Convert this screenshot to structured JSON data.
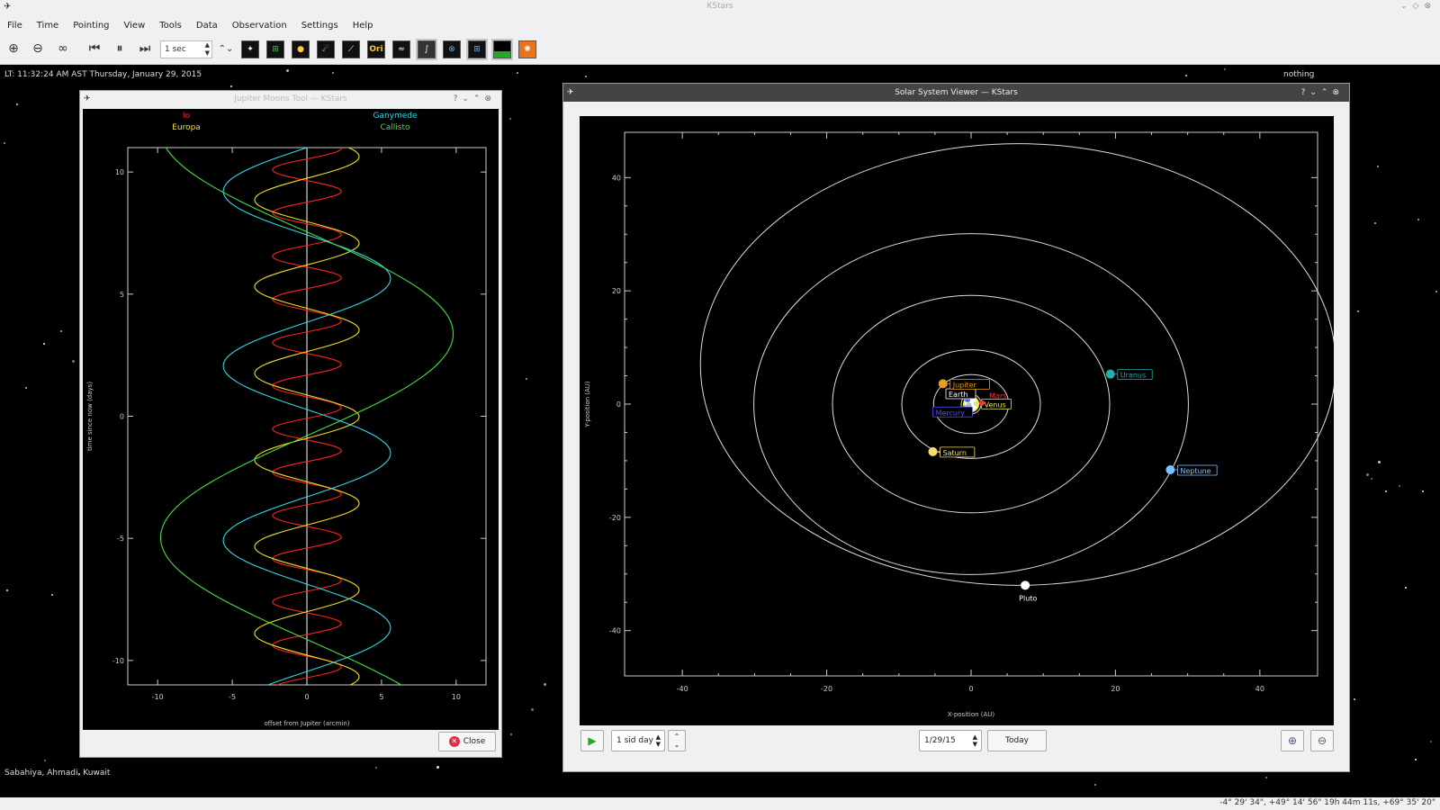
{
  "app": {
    "title": "KStars"
  },
  "menu": [
    "File",
    "Time",
    "Pointing",
    "View",
    "Tools",
    "Data",
    "Observation",
    "Settings",
    "Help"
  ],
  "toolbar": {
    "time_step": "1 sec",
    "view_buttons": [
      "stars",
      "const",
      "planets",
      "deep-sky",
      "lines",
      "Ori",
      "milky",
      "horizon",
      "grid",
      "eq",
      "ground",
      "fov"
    ]
  },
  "status": {
    "local_time": "LT: 11:32:24 AM AST   Thursday, January 29, 2015",
    "object": "nothing",
    "location": "Sabahiya, Ahmadi, Kuwait",
    "coords": "-4° 29' 34\", +49° 14' 56\"   19h 44m 11s, +69° 35' 20\""
  },
  "jupiter_window": {
    "title": "Jupiter Moons Tool — KStars",
    "close_label": "Close",
    "colors": {
      "io": "#ff2020",
      "europa": "#f0e020",
      "ganymede": "#30d8e8",
      "callisto": "#40e040"
    },
    "chart_data": {
      "type": "line",
      "xlabel": "offset from Jupiter (arcmin)",
      "ylabel": "time since now (days)",
      "xlim": [
        -12,
        12
      ],
      "ylim": [
        -11,
        11
      ],
      "x_ticks": [
        "-10",
        "-5",
        "0",
        "5",
        "10"
      ],
      "y_ticks": [
        "10",
        "5",
        "0",
        "-5",
        "-10"
      ],
      "series": [
        {
          "name": "Io",
          "amplitude": 2.3,
          "period_days": 1.77,
          "phase": 0.3
        },
        {
          "name": "Europa",
          "amplitude": 3.5,
          "period_days": 3.55,
          "phase": 1.6
        },
        {
          "name": "Ganymede",
          "amplitude": 5.6,
          "period_days": 7.15,
          "phase": 2.9
        },
        {
          "name": "Callisto",
          "amplitude": 9.8,
          "period_days": 16.69,
          "phase": 0.3
        }
      ]
    }
  },
  "solar_window": {
    "title": "Solar System Viewer — KStars",
    "step": "1 sid day",
    "date": "1/29/15",
    "today_label": "Today",
    "chart_data": {
      "type": "scatter",
      "xlabel": "X-position (AU)",
      "ylabel": "Y-position (AU)",
      "xlim": [
        -48,
        48
      ],
      "ylim": [
        -48,
        48
      ],
      "x_ticks": [
        "-40",
        "-20",
        "0",
        "20",
        "40"
      ],
      "y_ticks": [
        "40",
        "20",
        "0",
        "-20",
        "-40"
      ],
      "orbits": [
        {
          "name": "Jupiter",
          "a": 5.2,
          "cx": 0,
          "cy": 0
        },
        {
          "name": "Saturn",
          "a": 9.6,
          "cx": 0,
          "cy": 0
        },
        {
          "name": "Uranus",
          "a": 19.2,
          "cx": 0,
          "cy": 0
        },
        {
          "name": "Neptune",
          "a": 30.1,
          "cx": 0,
          "cy": 0
        },
        {
          "name": "Pluto",
          "rx": 44,
          "ry": 39,
          "cx": 6.5,
          "cy": 7
        }
      ],
      "planets": [
        {
          "name": "Mercury",
          "x": -0.3,
          "y": -0.2,
          "color": "#bbbbbb",
          "label_color": "#5050ff"
        },
        {
          "name": "Venus",
          "x": 0.7,
          "y": 0.1,
          "color": "#e0e0a0",
          "label_color": "#e0e060"
        },
        {
          "name": "Earth",
          "x": -0.5,
          "y": 0.8,
          "color": "#4060ff",
          "label_color": "#ffffff"
        },
        {
          "name": "Mars",
          "x": 1.5,
          "y": 0.2,
          "color": "#ff3030",
          "label_color": "#ff3030"
        },
        {
          "name": "Jupiter",
          "x": -3.9,
          "y": 3.6,
          "color": "#e0a020",
          "label_color": "#e0a020"
        },
        {
          "name": "Saturn",
          "x": -5.3,
          "y": -8.4,
          "color": "#f0e070",
          "label_color": "#f0e070"
        },
        {
          "name": "Uranus",
          "x": 19.3,
          "y": 5.3,
          "color": "#20b0b0",
          "label_color": "#20b0b0"
        },
        {
          "name": "Neptune",
          "x": 27.6,
          "y": -11.6,
          "color": "#80c0ff",
          "label_color": "#80c0ff"
        },
        {
          "name": "Pluto",
          "x": 7.5,
          "y": -32,
          "color": "#ffffff",
          "label_color": "#ffffff"
        }
      ]
    }
  }
}
